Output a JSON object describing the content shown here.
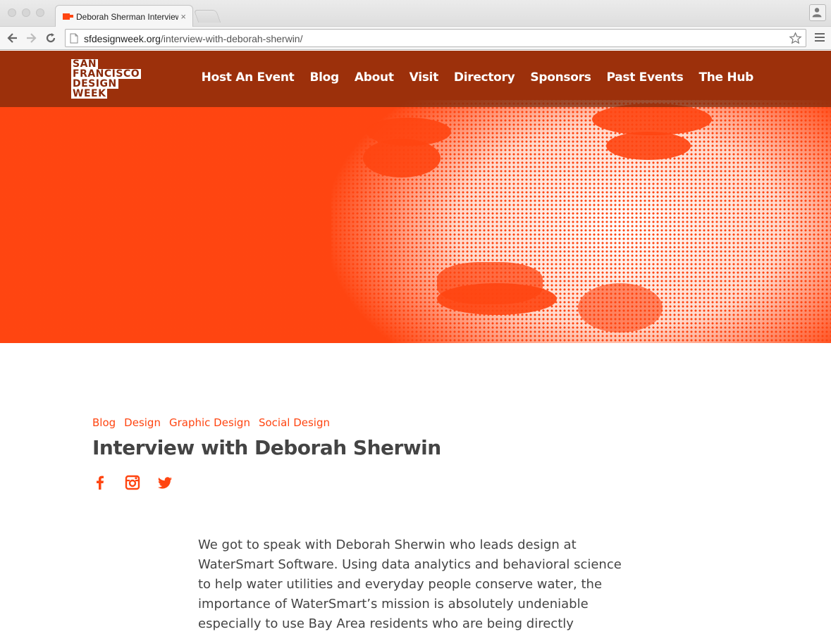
{
  "browser": {
    "tab_title": "Deborah Sherman Interview",
    "tab_close": "×",
    "url_host": "sfdesignweek.org",
    "url_path": "/interview-with-deborah-sherwin/"
  },
  "site": {
    "logo_lines": [
      "SAN",
      "FRANCISCO",
      "DESIGN",
      "WEEK"
    ],
    "nav": [
      "Host An Event",
      "Blog",
      "About",
      "Visit",
      "Directory",
      "Sponsors",
      "Past Events",
      "The Hub"
    ],
    "accent_color": "#ff4511"
  },
  "article": {
    "categories": [
      "Blog",
      "Design",
      "Graphic Design",
      "Social Design"
    ],
    "title": "Interview with Deborah Sherwin",
    "social_icons": [
      "facebook-icon",
      "instagram-icon",
      "twitter-icon"
    ],
    "body_lines": [
      "We got to speak with Deborah Sherwin who leads design at",
      "WaterSmart Software. Using data analytics and behavioral science",
      "to help water utilities and everyday people conserve water, the",
      "importance of WaterSmart’s mission is absolutely undeniable",
      "especially to use Bay Area residents who are being directly"
    ]
  }
}
